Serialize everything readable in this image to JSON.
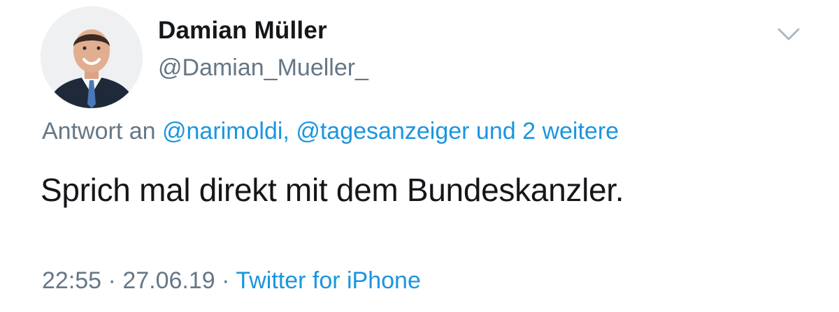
{
  "author": {
    "display_name": "Damian Müller",
    "handle": "@Damian_Mueller_",
    "avatar_icon": "profile-photo"
  },
  "caret_icon": "chevron-down-icon",
  "reply": {
    "prefix": "Antwort an",
    "mention1": "@narimoldi,",
    "mention2": "@tagesanzeiger",
    "suffix": "und 2 weitere"
  },
  "tweet_text": "Sprich mal direkt mit dem Bundeskanzler.",
  "meta": {
    "time": "22:55",
    "separator": "·",
    "date": "27.06.19",
    "source": "Twitter for iPhone"
  },
  "colors": {
    "link": "#1b95e0",
    "secondary_text": "#657786",
    "primary_text": "#14171a"
  }
}
